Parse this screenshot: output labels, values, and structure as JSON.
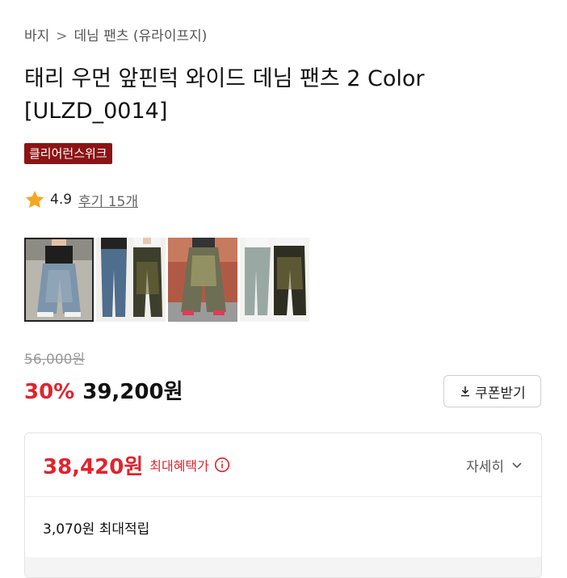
{
  "breadcrumb": {
    "parent": "바지",
    "separator": ">",
    "current": "데님 팬츠",
    "brand": "(유라이프지)"
  },
  "product": {
    "title": "태리 우먼 앞핀턱 와이드 데님 팬츠 2 Color [ULZD_0014]",
    "badge": "클리어런스위크"
  },
  "rating": {
    "score": "4.9",
    "reviews": "후기 15개",
    "star_color": "#f5a623",
    "icon": "star-icon"
  },
  "thumbnails": [
    {
      "label": "thumbnail-1",
      "selected": true
    },
    {
      "label": "thumbnail-2",
      "selected": false
    },
    {
      "label": "thumbnail-3",
      "selected": false
    },
    {
      "label": "thumbnail-4",
      "selected": false
    }
  ],
  "price": {
    "original": "56,000원",
    "discount": "30%",
    "sale": "39,200원",
    "discount_color": "#e0242d"
  },
  "coupon": {
    "label": "쿠폰받기",
    "icon": "download-icon"
  },
  "benefit": {
    "max_price": "38,420원",
    "max_label": "최대혜택가",
    "info_icon": "info-icon",
    "detail_label": "자세히",
    "chevron": "chevron-down-icon",
    "points": "3,070원 최대적립"
  }
}
